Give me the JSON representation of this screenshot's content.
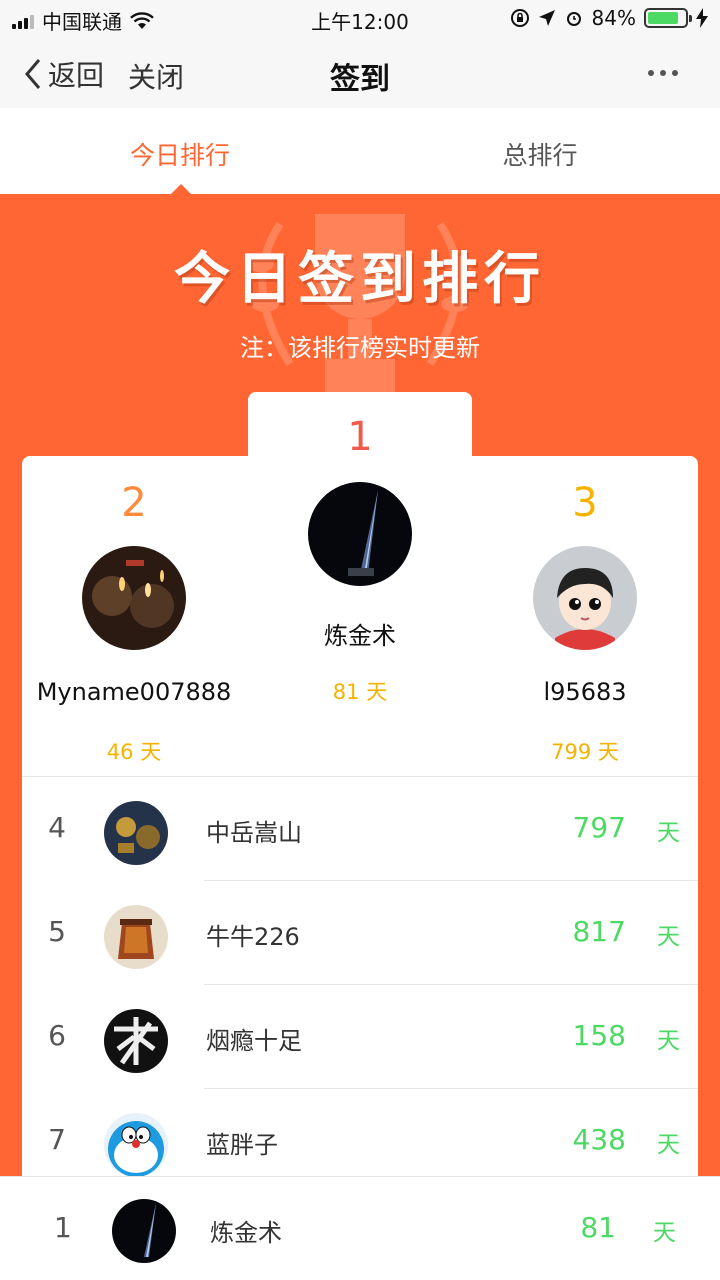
{
  "status_bar": {
    "carrier": "中国联通",
    "time": "上午12:00",
    "battery": "84%"
  },
  "nav": {
    "back_label": "返回",
    "close_label": "关闭",
    "title": "签到"
  },
  "tabs": {
    "today": "今日排行",
    "total": "总排行"
  },
  "banner": {
    "title": "今日签到排行",
    "note": "注：该排行榜实时更新"
  },
  "podium": {
    "first": {
      "rank": "1",
      "name": "炼金术",
      "days": "81 天"
    },
    "second": {
      "rank": "2",
      "name": "Myname007888",
      "days": "46 天"
    },
    "third": {
      "rank": "3",
      "name": "l95683",
      "days": "799 天"
    }
  },
  "list": [
    {
      "rank": "4",
      "name": "中岳嵩山",
      "count": "797",
      "unit": "天"
    },
    {
      "rank": "5",
      "name": "牛牛226",
      "count": "817",
      "unit": "天"
    },
    {
      "rank": "6",
      "name": "烟瘾十足",
      "count": "158",
      "unit": "天"
    },
    {
      "rank": "7",
      "name": "蓝胖子",
      "count": "438",
      "unit": "天"
    }
  ],
  "self": {
    "rank": "1",
    "name": "炼金术",
    "count": "81",
    "unit": "天"
  },
  "colors": {
    "accent": "#ff6633",
    "green": "#4cd964",
    "gold": "#f5b300",
    "red": "#f05a4a"
  }
}
